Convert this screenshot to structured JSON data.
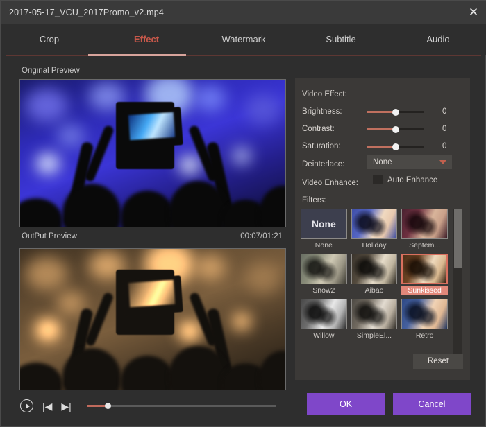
{
  "window": {
    "title": "2017-05-17_VCU_2017Promo_v2.mp4",
    "close_icon": "close-icon"
  },
  "tabs": [
    {
      "label": "Crop",
      "active": false
    },
    {
      "label": "Effect",
      "active": true
    },
    {
      "label": "Watermark",
      "active": false
    },
    {
      "label": "Subtitle",
      "active": false
    },
    {
      "label": "Audio",
      "active": false
    }
  ],
  "previews": {
    "original_label": "Original Preview",
    "output_label": "OutPut Preview",
    "timecode": "00:07/01:21"
  },
  "transport": {
    "play_icon": "play-icon",
    "prev_frame_icon": "previous-frame-icon",
    "prev_frame_glyph": "|◀",
    "next_frame_icon": "next-frame-icon",
    "next_frame_glyph": "▶|",
    "seek_position_percent": 10
  },
  "video_effect": {
    "section_title": "Video Effect:",
    "brightness": {
      "label": "Brightness:",
      "value": "0"
    },
    "contrast": {
      "label": "Contrast:",
      "value": "0"
    },
    "saturation": {
      "label": "Saturation:",
      "value": "0"
    },
    "deinterlace": {
      "label": "Deinterlace:",
      "value": "None",
      "chevron_icon": "chevron-down-icon"
    },
    "video_enhance": {
      "label": "Video Enhance:",
      "checkbox_label": "Auto Enhance",
      "checked": false
    }
  },
  "filters": {
    "section_title": "Filters:",
    "selected": "Sunkissed",
    "items": [
      {
        "name": "None"
      },
      {
        "name": "Holiday"
      },
      {
        "name": "Septem..."
      },
      {
        "name": "Snow2"
      },
      {
        "name": "Aibao"
      },
      {
        "name": "Sunkissed"
      },
      {
        "name": "Willow"
      },
      {
        "name": "SimpleEl..."
      },
      {
        "name": "Retro"
      }
    ],
    "scroll_thumb_percent": 40
  },
  "buttons": {
    "reset": "Reset",
    "ok": "OK",
    "cancel": "Cancel"
  },
  "colors": {
    "accent_red": "#c8584a",
    "slider_red": "#c0705f",
    "selection_salmon": "#e2887a",
    "primary_purple": "#7f47c9",
    "panel_bg": "#3b3937",
    "dialog_bg": "#2e2e2e",
    "titlebar_bg": "#3a3a3a"
  }
}
